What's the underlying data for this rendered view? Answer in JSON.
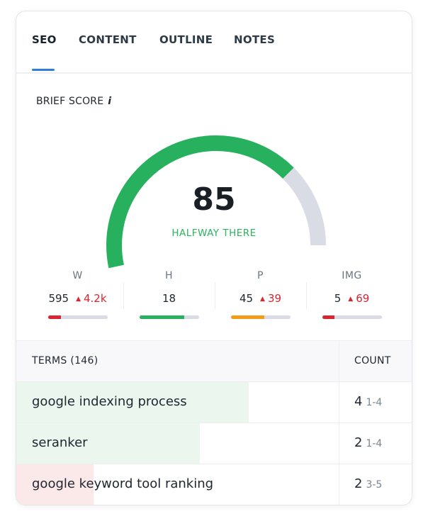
{
  "tabs": [
    {
      "label": "SEO",
      "active": true
    },
    {
      "label": "CONTENT",
      "active": false
    },
    {
      "label": "OUTLINE",
      "active": false
    },
    {
      "label": "NOTES",
      "active": false
    }
  ],
  "brief_score": {
    "label": "BRIEF SCORE",
    "info_glyph": "i",
    "score": 85,
    "status": "HALFWAY THERE",
    "colors": {
      "fill": "#27b05d",
      "track": "#d9dbe5",
      "status": "#2bb35f"
    }
  },
  "metrics": [
    {
      "label": "W",
      "value": "595",
      "target": "4.2k",
      "progress": 0.22,
      "color": "#d9252f"
    },
    {
      "label": "H",
      "value": "18",
      "target": null,
      "progress": 0.76,
      "color": "#27b05d"
    },
    {
      "label": "P",
      "value": "45",
      "target": "39",
      "progress": 0.57,
      "color": "#f39c1a"
    },
    {
      "label": "IMG",
      "value": "5",
      "target": "69",
      "progress": 0.21,
      "color": "#d9252f"
    }
  ],
  "terms_table": {
    "header_terms": "TERMS (146)",
    "header_count": "COUNT",
    "rows": [
      {
        "term": "google indexing process",
        "count": "4",
        "range": "1-4",
        "progress": 0.72,
        "color": "#ebf6ee"
      },
      {
        "term": "seranker",
        "count": "2",
        "range": "1-4",
        "progress": 0.57,
        "color": "#ebf6ee"
      },
      {
        "term": "google keyword tool ranking",
        "count": "2",
        "range": "3-5",
        "progress": 0.24,
        "color": "#fbe8e9"
      }
    ]
  }
}
